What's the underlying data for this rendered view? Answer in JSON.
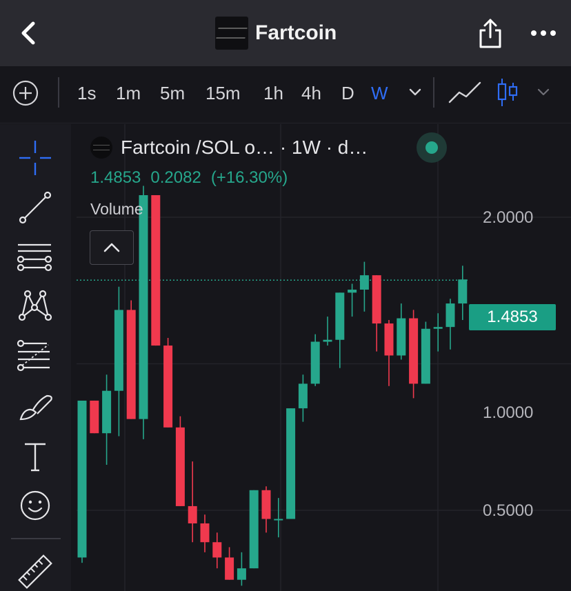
{
  "header": {
    "title": "Fartcoin",
    "back_icon": "chevron-left-icon",
    "share_icon": "share-icon",
    "more_icon": "more-horizontal-icon"
  },
  "toolbar": {
    "intervals": [
      "1s",
      "1m",
      "5m",
      "15m",
      "1h",
      "4h",
      "D",
      "W"
    ],
    "active_interval": "W",
    "icons": [
      "add-indicator-icon",
      "chevron-down-icon",
      "line-chart-icon",
      "candles-icon",
      "chevron-down-icon"
    ]
  },
  "drawing_tools": [
    "crosshair-icon",
    "trend-line-icon",
    "horizontal-lines-icon",
    "pattern-icon",
    "fib-retracement-icon",
    "brush-icon",
    "text-tool-icon",
    "emoji-icon",
    "ruler-icon"
  ],
  "legend": {
    "title": "Fartcoin /SOL o…  · 1W · d…",
    "close": "1.4853",
    "change": "0.2082",
    "change_pct": "(+16.30%)",
    "volume_label": "Volume"
  },
  "colors": {
    "up": "#26a78c",
    "down": "#f0394e",
    "accent": "#2f6df6",
    "price_tag": "#1a9e84"
  },
  "chart_data": {
    "type": "candlestick",
    "y_ticks": [
      "2.0000",
      "1.0000",
      "0.5000"
    ],
    "last_price_label": "1.4853",
    "ylim": [
      0.36,
      2.32
    ],
    "candles": [
      {
        "o": 0.4,
        "h": 0.84,
        "l": 0.39,
        "c": 0.84
      },
      {
        "o": 0.84,
        "h": 0.84,
        "l": 0.72,
        "c": 0.72
      },
      {
        "o": 0.72,
        "h": 0.95,
        "l": 0.62,
        "c": 0.88
      },
      {
        "o": 0.88,
        "h": 1.44,
        "l": 0.71,
        "c": 1.29
      },
      {
        "o": 1.29,
        "h": 1.35,
        "l": 0.77,
        "c": 0.77
      },
      {
        "o": 0.77,
        "h": 2.32,
        "l": 0.7,
        "c": 2.22
      },
      {
        "o": 2.22,
        "h": 2.22,
        "l": 1.09,
        "c": 1.09
      },
      {
        "o": 1.09,
        "h": 1.13,
        "l": 0.74,
        "c": 0.74
      },
      {
        "o": 0.74,
        "h": 0.78,
        "l": 0.51,
        "c": 0.51
      },
      {
        "o": 0.51,
        "h": 0.63,
        "l": 0.43,
        "c": 0.47
      },
      {
        "o": 0.47,
        "h": 0.49,
        "l": 0.41,
        "c": 0.43
      },
      {
        "o": 0.43,
        "h": 0.45,
        "l": 0.38,
        "c": 0.4
      },
      {
        "o": 0.4,
        "h": 0.42,
        "l": 0.36,
        "c": 0.36
      },
      {
        "o": 0.36,
        "h": 0.41,
        "l": 0.35,
        "c": 0.38
      },
      {
        "o": 0.38,
        "h": 0.55,
        "l": 0.38,
        "c": 0.55
      },
      {
        "o": 0.55,
        "h": 0.56,
        "l": 0.45,
        "c": 0.48
      },
      {
        "o": 0.48,
        "h": 0.53,
        "l": 0.44,
        "c": 0.48
      },
      {
        "o": 0.48,
        "h": 0.81,
        "l": 0.48,
        "c": 0.81
      },
      {
        "o": 0.81,
        "h": 0.95,
        "l": 0.76,
        "c": 0.91
      },
      {
        "o": 0.91,
        "h": 1.15,
        "l": 0.9,
        "c": 1.11
      },
      {
        "o": 1.11,
        "h": 1.25,
        "l": 1.09,
        "c": 1.12
      },
      {
        "o": 1.12,
        "h": 1.4,
        "l": 0.98,
        "c": 1.4
      },
      {
        "o": 1.4,
        "h": 1.46,
        "l": 1.25,
        "c": 1.42
      },
      {
        "o": 1.42,
        "h": 1.62,
        "l": 1.28,
        "c": 1.52
      },
      {
        "o": 1.52,
        "h": 1.52,
        "l": 1.06,
        "c": 1.21
      },
      {
        "o": 1.21,
        "h": 1.23,
        "l": 0.9,
        "c": 1.04
      },
      {
        "o": 1.04,
        "h": 1.33,
        "l": 1.02,
        "c": 1.24
      },
      {
        "o": 1.24,
        "h": 1.29,
        "l": 0.85,
        "c": 0.91
      },
      {
        "o": 0.91,
        "h": 1.22,
        "l": 0.91,
        "c": 1.18
      },
      {
        "o": 1.18,
        "h": 1.27,
        "l": 1.06,
        "c": 1.19
      },
      {
        "o": 1.19,
        "h": 1.36,
        "l": 1.07,
        "c": 1.33
      },
      {
        "o": 1.33,
        "h": 1.59,
        "l": 1.23,
        "c": 1.49
      }
    ]
  }
}
